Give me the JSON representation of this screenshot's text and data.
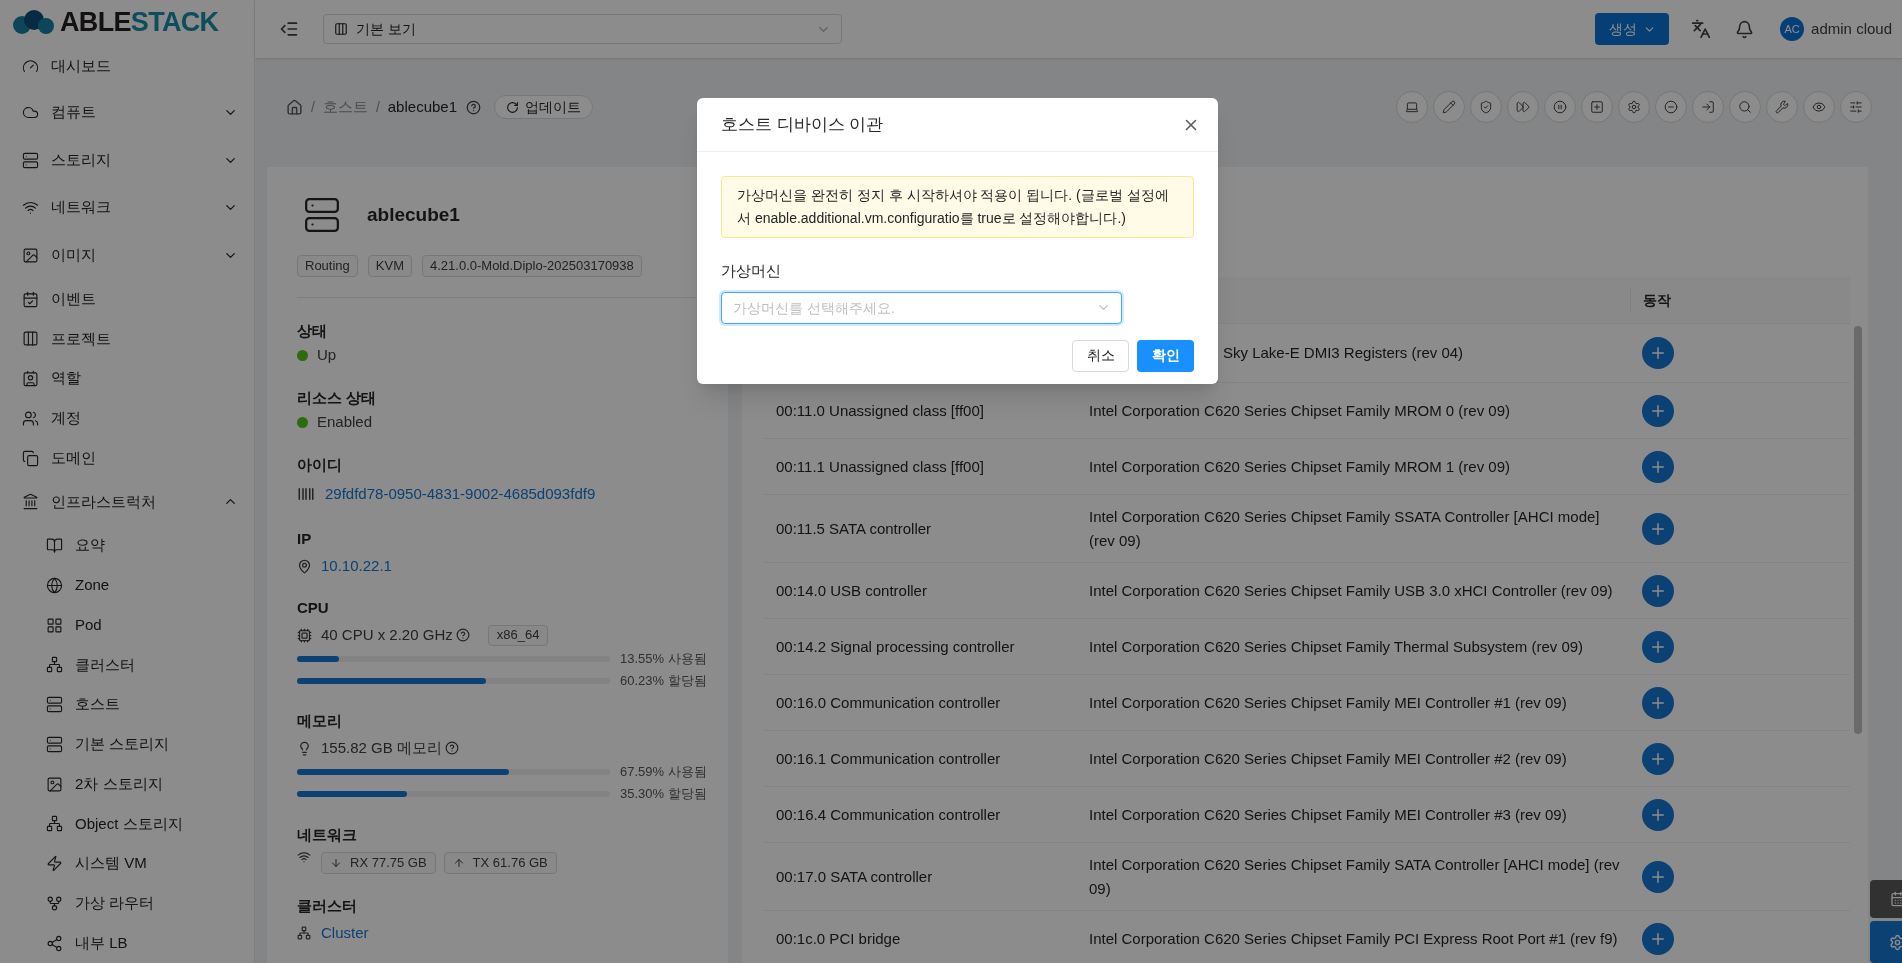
{
  "logo": {
    "part_a": "ABLE",
    "part_b": "STACK"
  },
  "header": {
    "view_select": {
      "value": "기본 보기"
    },
    "create_button": "생성",
    "user": {
      "initials": "AC",
      "name": "admin cloud"
    }
  },
  "sidebar": {
    "items": [
      {
        "label": "대시보드"
      },
      {
        "label": "컴퓨트",
        "expanded": false
      },
      {
        "label": "스토리지",
        "expanded": false
      },
      {
        "label": "네트워크",
        "expanded": false
      },
      {
        "label": "이미지",
        "expanded": false
      },
      {
        "label": "이벤트"
      },
      {
        "label": "프로젝트"
      },
      {
        "label": "역할"
      },
      {
        "label": "계정"
      },
      {
        "label": "도메인"
      },
      {
        "label": "인프라스트럭처",
        "expanded": true,
        "children": [
          {
            "label": "요약"
          },
          {
            "label": "Zone"
          },
          {
            "label": "Pod"
          },
          {
            "label": "클러스터"
          },
          {
            "label": "호스트"
          },
          {
            "label": "기본 스토리지"
          },
          {
            "label": "2차 스토리지"
          },
          {
            "label": "Object 스토리지"
          },
          {
            "label": "시스템 VM"
          },
          {
            "label": "가상 라우터"
          },
          {
            "label": "내부 LB"
          }
        ]
      }
    ]
  },
  "breadcrumb": [
    {
      "separator": "/",
      "label": "호스트"
    },
    {
      "separator": "/",
      "label": "ablecube1"
    }
  ],
  "update_button": "업데이트",
  "host": {
    "name": "ablecube1",
    "tags": [
      "Routing",
      "KVM",
      "4.21.0.0-Mold.Diplo-202503170938"
    ],
    "status": {
      "label": "상태",
      "value": "Up",
      "color": "#2d6c0e"
    },
    "resource_state": {
      "label": "리소스 상태",
      "value": "Enabled",
      "color": "#2d6c0e"
    },
    "id": {
      "label": "아이디",
      "value": "29fdfd78-0950-4831-9002-4685d093fdf9"
    },
    "ip": {
      "label": "IP",
      "value": "10.10.22.1"
    },
    "cpu": {
      "label": "CPU",
      "value": "40 CPU x 2.20 GHz",
      "arch": "x86_64",
      "bars": [
        {
          "level": 0.1355,
          "reading": "13.55% 사용됨"
        },
        {
          "level": 0.6023,
          "reading": "60.23% 할당됨"
        }
      ]
    },
    "memory": {
      "label": "메모리",
      "value": "155.82 GB 메모리",
      "bars": [
        {
          "level": 0.6759,
          "reading": "67.59% 사용됨"
        },
        {
          "level": 0.353,
          "reading": "35.30% 할당됨"
        }
      ]
    },
    "network": {
      "label": "네트워크",
      "rx": "RX 77.75 GB",
      "tx": "TX 61.76 GB"
    },
    "cluster": {
      "label": "클러스터",
      "value": "Cluster"
    }
  },
  "table": {
    "action_column": "동작",
    "rows": [
      {
        "description": "Sky Lake-E DMI3 Registers (rev 04)"
      },
      {
        "device": "00:11.0 Unassigned class [ff00]",
        "description": "Intel Corporation C620 Series Chipset Family MROM 0 (rev 09)"
      },
      {
        "device": "00:11.1 Unassigned class [ff00]",
        "description": "Intel Corporation C620 Series Chipset Family MROM 1 (rev 09)"
      },
      {
        "device": "00:11.5 SATA controller",
        "description": "Intel Corporation C620 Series Chipset Family SSATA Controller [AHCI mode] (rev 09)"
      },
      {
        "device": "00:14.0 USB controller",
        "description": "Intel Corporation C620 Series Chipset Family USB 3.0 xHCI Controller (rev 09)"
      },
      {
        "device": "00:14.2 Signal processing controller",
        "description": "Intel Corporation C620 Series Chipset Family Thermal Subsystem (rev 09)"
      },
      {
        "device": "00:16.0 Communication controller",
        "description": "Intel Corporation C620 Series Chipset Family MEI Controller #1 (rev 09)"
      },
      {
        "device": "00:16.1 Communication controller",
        "description": "Intel Corporation C620 Series Chipset Family MEI Controller #2 (rev 09)"
      },
      {
        "device": "00:16.4 Communication controller",
        "description": "Intel Corporation C620 Series Chipset Family MEI Controller #3 (rev 09)"
      },
      {
        "device": "00:17.0 SATA controller",
        "description": "Intel Corporation C620 Series Chipset Family SATA Controller [AHCI mode] (rev 09)"
      },
      {
        "device": "00:1c.0 PCI bridge",
        "description": "Intel Corporation C620 Series Chipset Family PCI Express Root Port #1 (rev f9)"
      }
    ]
  },
  "modal": {
    "title": "호스트 디바이스 이관",
    "alert": "가상머신을 완전히 정지 후 시작하셔야 적용이 됩니다. (글로벌 설정에서 enable.additional.vm.configuratio를 true로 설정해야합니다.)",
    "field_label": "가상머신",
    "placeholder": "가상머신를 선택해주세요.",
    "cancel": "취소",
    "ok": "확인"
  }
}
